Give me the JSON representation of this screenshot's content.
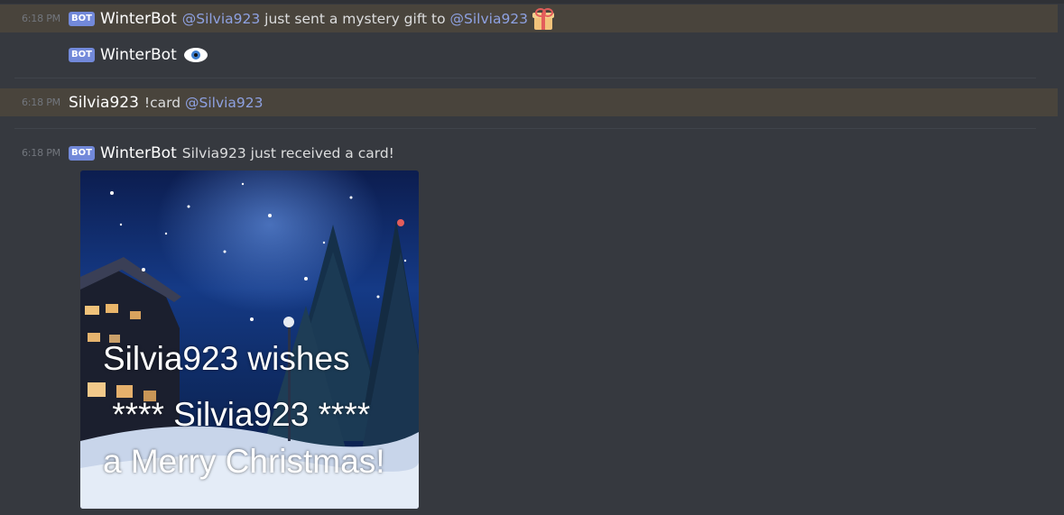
{
  "messages": [
    {
      "time": "6:18 PM",
      "bot_tag": "BOT",
      "author": "WinterBot",
      "mention1": "@Silvia923",
      "text": " just sent a mystery gift to ",
      "mention2": "@Silvia923",
      "icon": "gift-icon"
    },
    {
      "bot_tag": "BOT",
      "author": "WinterBot",
      "icon": "eye-icon"
    },
    {
      "time": "6:18 PM",
      "author": "Silvia923",
      "text": "!card ",
      "mention1": "@Silvia923"
    },
    {
      "time": "6:18 PM",
      "bot_tag": "BOT",
      "author": "WinterBot",
      "text": "Silvia923 just received a card!"
    }
  ],
  "card": {
    "line1": "Silvia923 wishes",
    "line2": " **** Silvia923 ****",
    "line3": "a Merry Christmas!"
  },
  "colors": {
    "background": "#36393f",
    "mention_highlight": "#49443c",
    "mention_text": "#8ea1e1",
    "bot_tag": "#7289da",
    "timestamp": "#72767d"
  }
}
